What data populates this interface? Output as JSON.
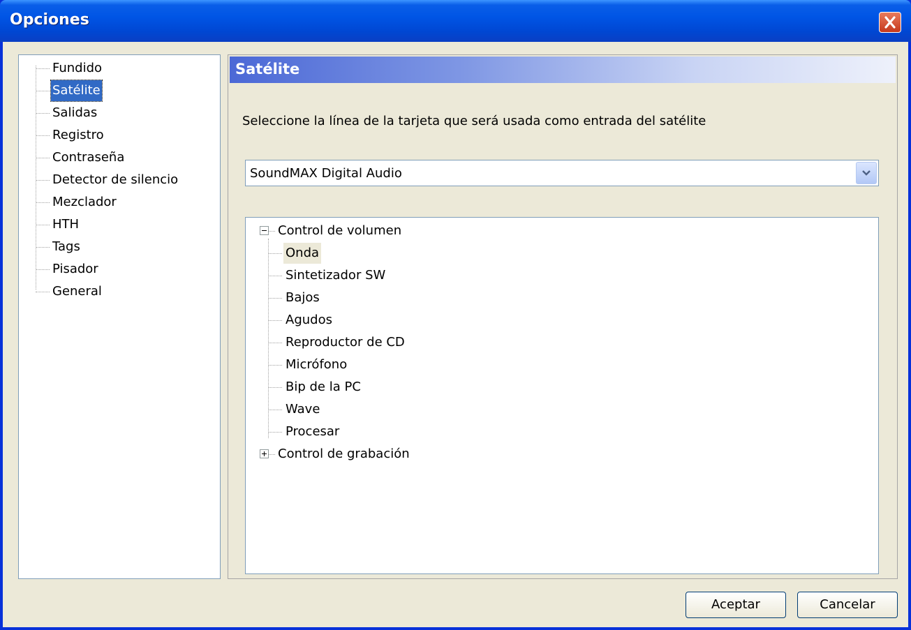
{
  "window": {
    "title": "Opciones"
  },
  "nav": {
    "items": [
      {
        "label": "Fundido"
      },
      {
        "label": "Satélite",
        "selected": true
      },
      {
        "label": "Salidas"
      },
      {
        "label": "Registro"
      },
      {
        "label": "Contraseña"
      },
      {
        "label": "Detector de silencio"
      },
      {
        "label": "Mezclador"
      },
      {
        "label": "HTH"
      },
      {
        "label": "Tags"
      },
      {
        "label": "Pisador"
      },
      {
        "label": "General"
      }
    ]
  },
  "panel": {
    "title": "Satélite",
    "description": "Seleccione la línea de la tarjeta que será usada como entrada del satélite",
    "device_select": {
      "value": "SoundMAX Digital Audio"
    },
    "tree": {
      "nodes": [
        {
          "label": "Control de volumen",
          "expanded": true,
          "children": [
            {
              "label": "Onda",
              "selected": true
            },
            {
              "label": "Sintetizador SW"
            },
            {
              "label": "Bajos"
            },
            {
              "label": "Agudos"
            },
            {
              "label": "Reproductor de CD"
            },
            {
              "label": "Micrófono"
            },
            {
              "label": "Bip de la PC"
            },
            {
              "label": "Wave"
            },
            {
              "label": "Procesar"
            }
          ]
        },
        {
          "label": "Control de grabación",
          "expanded": false
        }
      ]
    }
  },
  "buttons": {
    "ok": "Aceptar",
    "cancel": "Cancelar"
  }
}
